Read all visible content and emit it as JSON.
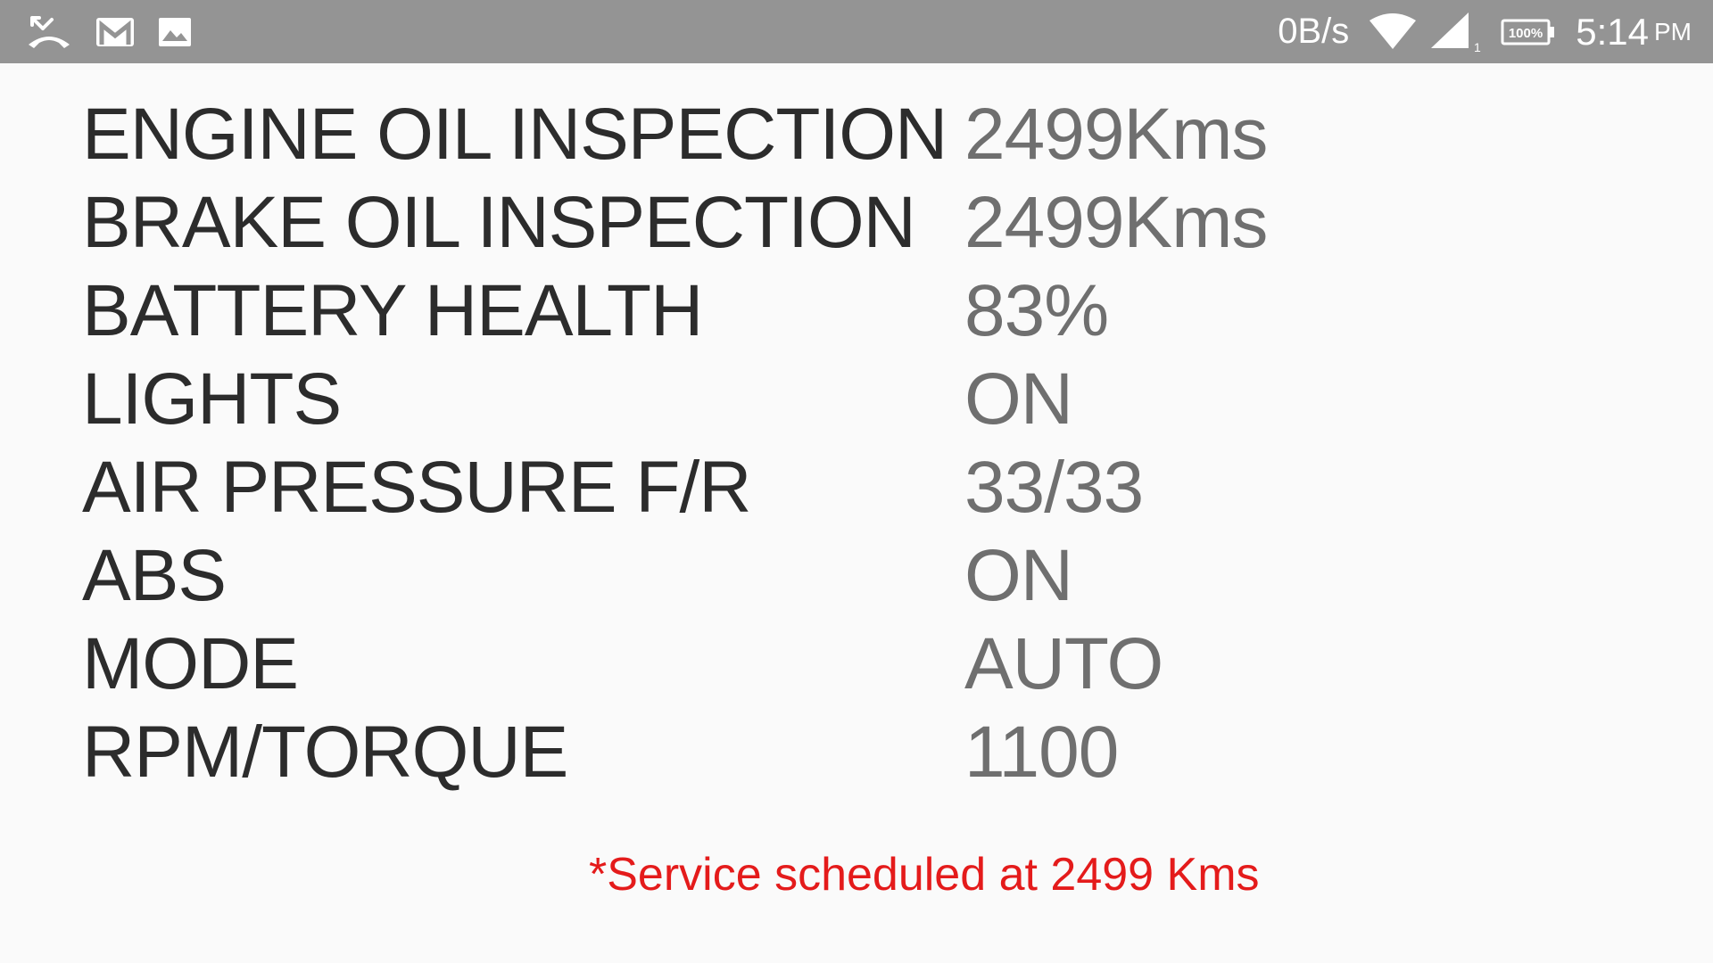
{
  "status_bar": {
    "left_icons": [
      "missed-call-icon",
      "gmail-icon",
      "image-icon"
    ],
    "net_speed": "0B/s",
    "wifi": "wifi-icon",
    "signal": "cell-signal-icon",
    "signal_sim": "1",
    "battery": "100%",
    "time": "5:14",
    "ampm": "PM"
  },
  "vehicle_status": {
    "rows": [
      {
        "label": "ENGINE OIL INSPECTION",
        "value": "2499Kms"
      },
      {
        "label": "BRAKE OIL INSPECTION",
        "value": "2499Kms"
      },
      {
        "label": "BATTERY HEALTH",
        "value": "83%"
      },
      {
        "label": "LIGHTS",
        "value": "ON"
      },
      {
        "label": "AIR PRESSURE F/R",
        "value": "33/33"
      },
      {
        "label": "ABS",
        "value": "ON"
      },
      {
        "label": "MODE",
        "value": "AUTO"
      },
      {
        "label": "RPM/TORQUE",
        "value": "1100"
      }
    ]
  },
  "service_note": "*Service scheduled at 2499 Kms",
  "colors": {
    "status_bar_bg": "#949494",
    "label": "#2c2c2c",
    "value": "#6f6f6f",
    "note": "#e41b1b",
    "background": "#fafafa"
  }
}
